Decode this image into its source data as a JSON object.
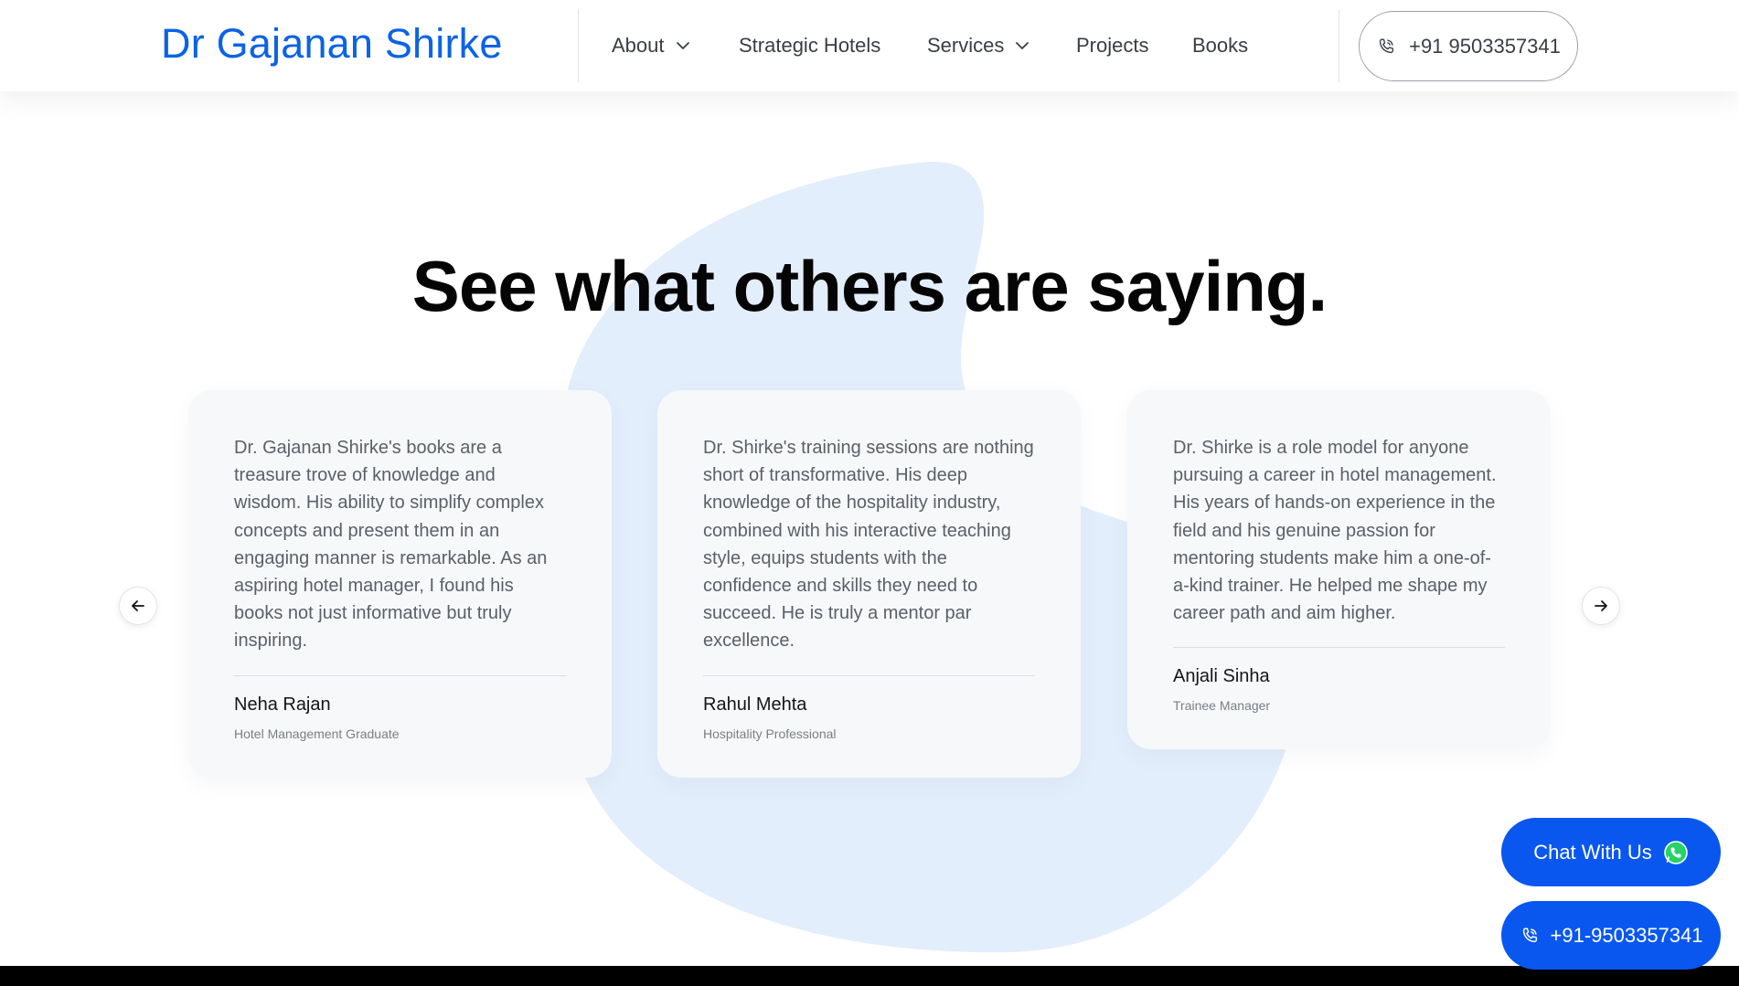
{
  "header": {
    "logo": "Dr Gajanan Shirke",
    "nav": [
      {
        "label": "About",
        "dropdown": true
      },
      {
        "label": "Strategic Hotels",
        "dropdown": false
      },
      {
        "label": "Services",
        "dropdown": true
      },
      {
        "label": "Projects",
        "dropdown": false
      },
      {
        "label": "Books",
        "dropdown": false
      }
    ],
    "phone": "+91 9503357341",
    "phone_icon": "phone-icon"
  },
  "testimonials": {
    "title": "See what others are saying.",
    "cards": [
      {
        "quote": "Dr. Gajanan Shirke's books are a treasure trove of knowledge and wisdom. His ability to simplify complex concepts and present them in an engaging manner is remarkable. As an aspiring hotel manager, I found his books not just informative but truly inspiring.",
        "name": "Neha Rajan",
        "role": "Hotel Management Graduate"
      },
      {
        "quote": "Dr. Shirke's training sessions are nothing short of transformative. His deep knowledge of the hospitality industry, combined with his interactive teaching style, equips students with the confidence and skills they need to succeed. He is truly a mentor par excellence.",
        "name": "Rahul Mehta",
        "role": "Hospitality Professional"
      },
      {
        "quote": "Dr. Shirke is a role model for anyone pursuing a career in hotel management. His years of hands-on experience in the field and his genuine passion for mentoring students make him a one-of-a-kind trainer. He helped me shape my career path and aim higher.",
        "name": "Anjali Sinha",
        "role": "Trainee Manager"
      }
    ],
    "prev_icon": "arrow-left-icon",
    "next_icon": "arrow-right-icon"
  },
  "floating": {
    "chat_label": "Chat With Us",
    "chat_icon": "whatsapp-icon",
    "call_label": "+91-9503357341",
    "call_icon": "phone-icon"
  },
  "colors": {
    "brand_blue": "#0b63e5",
    "button_blue": "#0a57f0",
    "blob": "#e3eefc",
    "card_bg": "#f7f8fa"
  }
}
